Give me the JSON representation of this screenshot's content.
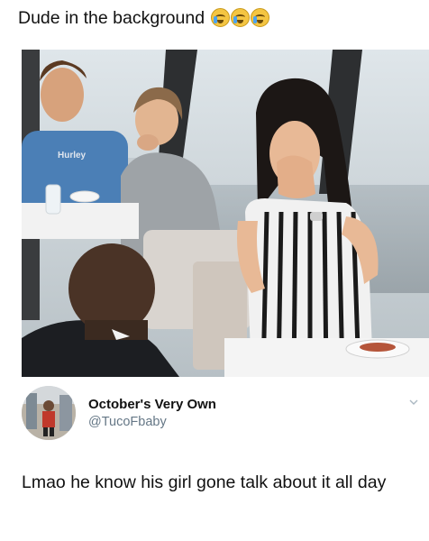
{
  "caption": {
    "text": "Dude in the background",
    "emojis": [
      "crying-face-icon",
      "crying-face-icon",
      "crying-face-icon"
    ]
  },
  "photo": {
    "subject": "proposal-photo"
  },
  "tweet": {
    "display_name": "October's Very Own",
    "handle": "@TucoFbaby",
    "text": "Lmao he know his girl gone talk about it all day"
  },
  "colors": {
    "handle": "#657786",
    "text": "#111111",
    "background": "#ffffff"
  }
}
